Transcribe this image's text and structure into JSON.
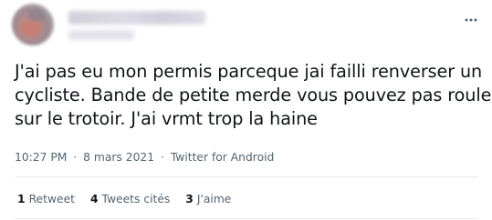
{
  "tweet": {
    "text_lines": [
      "J'ai pas eu mon permis parceque jai failli renverser un",
      "cycliste. Bande de petite merde vous pouvez pas rouler",
      "sur le trotoir. J'ai vrmt trop la haine"
    ],
    "time": "10:27 PM",
    "separator1": "·",
    "date": "8 mars 2021",
    "separator2": "·",
    "source": "Twitter for Android"
  },
  "stats": {
    "retweets": {
      "count": "1",
      "label": "Retweet"
    },
    "quotes": {
      "count": "4",
      "label": "Tweets cités"
    },
    "likes": {
      "count": "3",
      "label": "J'aime"
    }
  },
  "icons": {
    "more": "more-horizontal-icon"
  },
  "colors": {
    "text_primary": "#0f1419",
    "text_secondary": "#536471",
    "divider": "#e6ecf0"
  }
}
